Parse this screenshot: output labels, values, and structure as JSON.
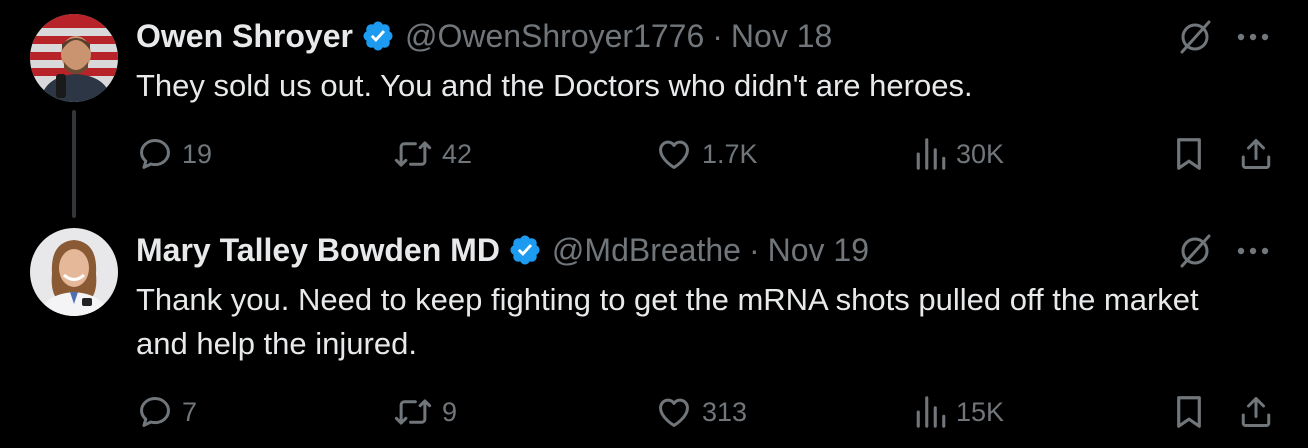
{
  "tweets": [
    {
      "name": "Owen Shroyer",
      "handle": "@OwenShroyer1776",
      "separator": "·",
      "date": "Nov 18",
      "text": "They sold us out. You and the Doctors who didn't are heroes.",
      "replies": "19",
      "reposts": "42",
      "likes": "1.7K",
      "views": "30K"
    },
    {
      "name": "Mary Talley Bowden MD",
      "handle": "@MdBreathe",
      "separator": "·",
      "date": "Nov 19",
      "text": "Thank you.  Need to keep fighting to get the mRNA shots pulled off the market and help the injured.",
      "replies": "7",
      "reposts": "9",
      "likes": "313",
      "views": "15K"
    }
  ],
  "icons": {
    "verified": "verified-badge-icon",
    "grok": "grok-icon",
    "more": "more-icon",
    "reply": "reply-icon",
    "repost": "repost-icon",
    "like": "like-icon",
    "views": "views-icon",
    "bookmark": "bookmark-icon",
    "share": "share-icon"
  },
  "colors": {
    "background": "#000000",
    "text": "#e7e9ea",
    "muted": "#71767b",
    "verified": "#1d9bf0",
    "thread_line": "#333639"
  }
}
